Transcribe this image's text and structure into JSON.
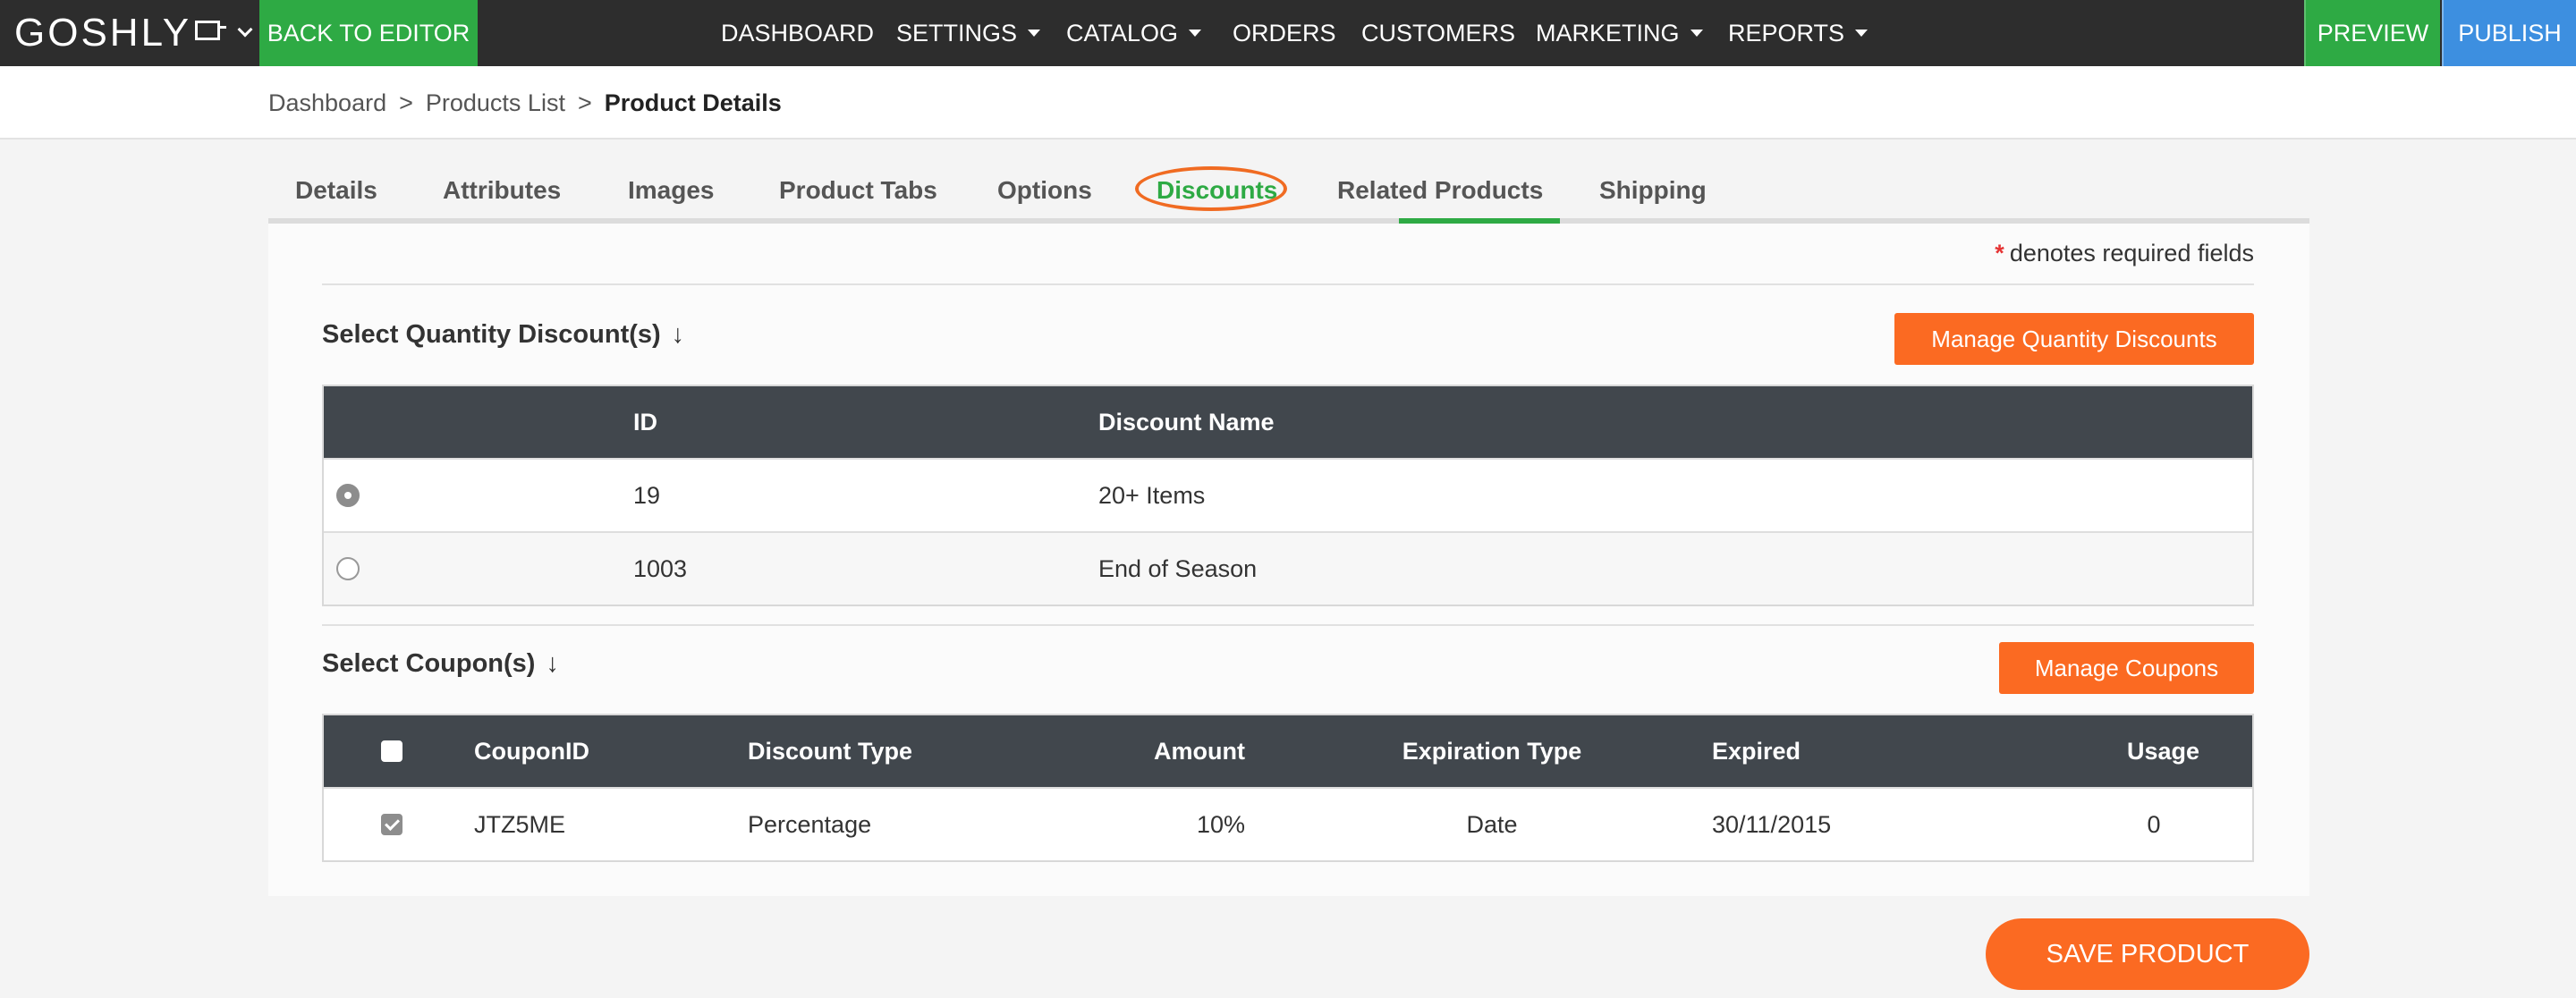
{
  "topbar": {
    "logo": "GOSHLY",
    "back_to_editor": "BACK TO EDITOR",
    "nav": [
      {
        "label": "DASHBOARD"
      },
      {
        "label": "SETTINGS"
      },
      {
        "label": "CATALOG"
      },
      {
        "label": "ORDERS"
      },
      {
        "label": "CUSTOMERS"
      },
      {
        "label": "MARKETING"
      },
      {
        "label": "REPORTS"
      }
    ],
    "preview": "PREVIEW",
    "publish": "PUBLISH"
  },
  "breadcrumb": {
    "items": [
      "Dashboard",
      "Products List"
    ],
    "current": "Product Details",
    "separator": ">"
  },
  "tabs": [
    {
      "label": "Details"
    },
    {
      "label": "Attributes"
    },
    {
      "label": "Images"
    },
    {
      "label": "Product Tabs"
    },
    {
      "label": "Options"
    },
    {
      "label": "Discounts",
      "active": true
    },
    {
      "label": "Related Products"
    },
    {
      "label": "Shipping"
    }
  ],
  "required_note": {
    "star": "*",
    "text": "denotes required fields"
  },
  "quantity_discounts": {
    "title": "Select Quantity Discount(s)",
    "arrow": "↓",
    "manage_button": "Manage Quantity Discounts",
    "columns": {
      "id": "ID",
      "name": "Discount Name"
    },
    "rows": [
      {
        "id": "19",
        "name": "20+ Items",
        "selected": true
      },
      {
        "id": "1003",
        "name": "End of Season",
        "selected": false
      }
    ]
  },
  "coupons": {
    "title": "Select Coupon(s)",
    "arrow": "↓",
    "manage_button": "Manage Coupons",
    "columns": {
      "coupon_id": "CouponID",
      "discount_type": "Discount Type",
      "amount": "Amount",
      "expiration_type": "Expiration Type",
      "expired": "Expired",
      "usage": "Usage"
    },
    "rows": [
      {
        "checked": true,
        "coupon_id": "JTZ5ME",
        "discount_type": "Percentage",
        "amount": "10%",
        "expiration_type": "Date",
        "expired": "30/11/2015",
        "usage": "0"
      }
    ]
  },
  "save_button": "SAVE PRODUCT",
  "colors": {
    "topbar": "#2d2d2d",
    "green": "#2eaa44",
    "blue": "#3d8fe0",
    "orange": "#fb6a22",
    "table_header": "#41474d"
  }
}
